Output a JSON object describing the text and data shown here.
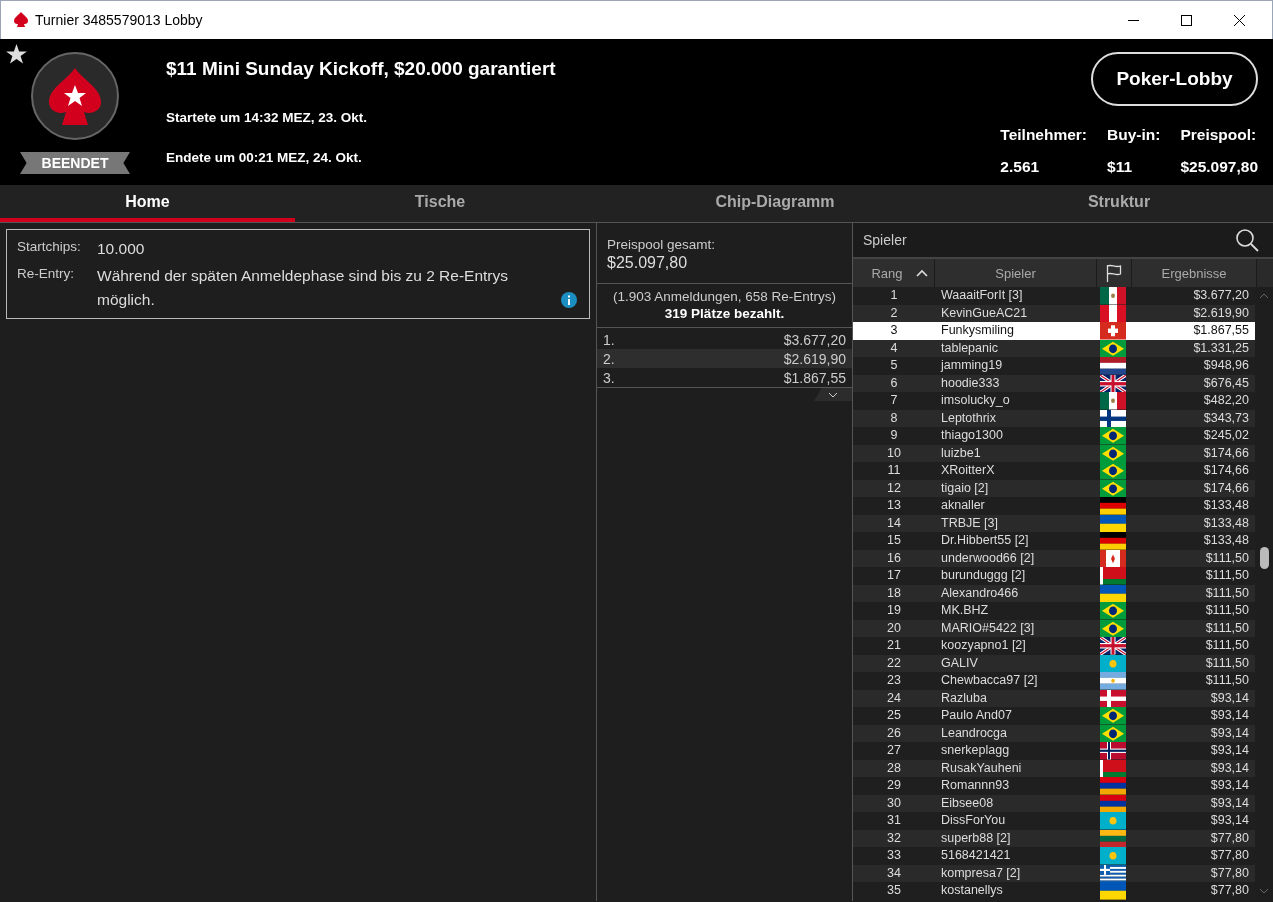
{
  "window": {
    "title": "Turnier 3485579013 Lobby"
  },
  "header": {
    "status": "BEENDET",
    "title": "$11 Mini Sunday Kickoff, $20.000 garantiert",
    "started": "Startete um 14:32 MEZ, 23. Okt.",
    "ended": "Endete um 00:21 MEZ, 24. Okt.",
    "lobby_button": "Poker-Lobby",
    "stats": [
      {
        "label": "Teilnehmer:",
        "value": "2.561"
      },
      {
        "label": "Buy-in:",
        "value": "$11"
      },
      {
        "label": "Preispool:",
        "value": "$25.097,80"
      }
    ]
  },
  "tabs": [
    {
      "label": "Home",
      "selected": true
    },
    {
      "label": "Tische",
      "selected": false
    },
    {
      "label": "Chip-Diagramm",
      "selected": false
    },
    {
      "label": "Struktur",
      "selected": false
    }
  ],
  "info": [
    {
      "label": "Startchips:",
      "value": "10.000",
      "info_icon": false
    },
    {
      "label": "Re-Entry:",
      "value": "Während der späten Anmeldephase sind bis zu 2 Re-Entrys möglich.",
      "info_icon": true
    }
  ],
  "prize_pool": {
    "label": "Preispool gesamt:",
    "value": "$25.097,80",
    "entries": "(1.903 Anmeldungen, 658 Re-Entrys)",
    "paid": "319 Plätze bezahlt.",
    "places": [
      {
        "place": "1.",
        "prize": "$3.677,20"
      },
      {
        "place": "2.",
        "prize": "$2.619,90"
      },
      {
        "place": "3.",
        "prize": "$1.867,55"
      }
    ]
  },
  "players": {
    "search_label": "Spieler",
    "columns": [
      "Rang",
      "Spieler",
      "Ergebnisse"
    ],
    "rows": [
      {
        "rank": "1",
        "name": "WaaaitForIt [3]",
        "kind": "mx",
        "result": "$3.677,20",
        "selected": false
      },
      {
        "rank": "2",
        "name": "KevinGueAC21",
        "kind": "pe",
        "result": "$2.619,90",
        "selected": false
      },
      {
        "rank": "3",
        "name": "Funkysmiling",
        "kind": "ch",
        "result": "$1.867,55",
        "selected": true
      },
      {
        "rank": "4",
        "name": "tablepanic",
        "kind": "br",
        "result": "$1.331,25",
        "selected": false
      },
      {
        "rank": "5",
        "name": "jamming19",
        "kind": "nl",
        "result": "$948,96",
        "selected": false
      },
      {
        "rank": "6",
        "name": "hoodie333",
        "kind": "gb",
        "result": "$676,45",
        "selected": false
      },
      {
        "rank": "7",
        "name": "imsolucky_o",
        "kind": "mx",
        "result": "$482,20",
        "selected": false
      },
      {
        "rank": "8",
        "name": "Leptothrix",
        "kind": "fi",
        "result": "$343,73",
        "selected": false
      },
      {
        "rank": "9",
        "name": "thiago1300",
        "kind": "br",
        "result": "$245,02",
        "selected": false
      },
      {
        "rank": "10",
        "name": "luizbe1",
        "kind": "br",
        "result": "$174,66",
        "selected": false
      },
      {
        "rank": "11",
        "name": "XRoitterX",
        "kind": "br",
        "result": "$174,66",
        "selected": false
      },
      {
        "rank": "12",
        "name": "tigaio [2]",
        "kind": "br",
        "result": "$174,66",
        "selected": false
      },
      {
        "rank": "13",
        "name": "aknaller",
        "kind": "de",
        "result": "$133,48",
        "selected": false
      },
      {
        "rank": "14",
        "name": "TRBJE [3]",
        "kind": "ua",
        "result": "$133,48",
        "selected": false
      },
      {
        "rank": "15",
        "name": "Dr.Hibbert55 [2]",
        "kind": "de",
        "result": "$133,48",
        "selected": false
      },
      {
        "rank": "16",
        "name": "underwood66 [2]",
        "kind": "ca",
        "result": "$111,50",
        "selected": false
      },
      {
        "rank": "17",
        "name": "burunduggg [2]",
        "kind": "by",
        "result": "$111,50",
        "selected": false
      },
      {
        "rank": "18",
        "name": "Alexandro466",
        "kind": "ua",
        "result": "$111,50",
        "selected": false
      },
      {
        "rank": "19",
        "name": "MK.BHZ",
        "kind": "br",
        "result": "$111,50",
        "selected": false
      },
      {
        "rank": "20",
        "name": "MARIO#5422 [3]",
        "kind": "br",
        "result": "$111,50",
        "selected": false
      },
      {
        "rank": "21",
        "name": "koozyapno1 [2]",
        "kind": "gb",
        "result": "$111,50",
        "selected": false
      },
      {
        "rank": "22",
        "name": "GALIV",
        "kind": "kz",
        "result": "$111,50",
        "selected": false
      },
      {
        "rank": "23",
        "name": "Chewbacca97 [2]",
        "kind": "ar",
        "result": "$111,50",
        "selected": false
      },
      {
        "rank": "24",
        "name": "Razluba",
        "kind": "dk",
        "result": "$93,14",
        "selected": false
      },
      {
        "rank": "25",
        "name": "Paulo And07",
        "kind": "br",
        "result": "$93,14",
        "selected": false
      },
      {
        "rank": "26",
        "name": "Leandrocga",
        "kind": "br",
        "result": "$93,14",
        "selected": false
      },
      {
        "rank": "27",
        "name": "snerkeplagg",
        "kind": "no",
        "result": "$93,14",
        "selected": false
      },
      {
        "rank": "28",
        "name": "RusakYauheni",
        "kind": "by",
        "result": "$93,14",
        "selected": false
      },
      {
        "rank": "29",
        "name": "Romannn93",
        "kind": "am",
        "result": "$93,14",
        "selected": false
      },
      {
        "rank": "30",
        "name": "Eibsee08",
        "kind": "am",
        "result": "$93,14",
        "selected": false
      },
      {
        "rank": "31",
        "name": "DissForYou",
        "kind": "kz",
        "result": "$93,14",
        "selected": false
      },
      {
        "rank": "32",
        "name": "superb88 [2]",
        "kind": "lt",
        "result": "$77,80",
        "selected": false
      },
      {
        "rank": "33",
        "name": "5168421421",
        "kind": "kz",
        "result": "$77,80",
        "selected": false
      },
      {
        "rank": "34",
        "name": "kompresa7 [2]",
        "kind": "gr",
        "result": "$77,80",
        "selected": false
      },
      {
        "rank": "35",
        "name": "kostanellys",
        "kind": "ua",
        "result": "$77,80",
        "selected": false
      }
    ]
  }
}
